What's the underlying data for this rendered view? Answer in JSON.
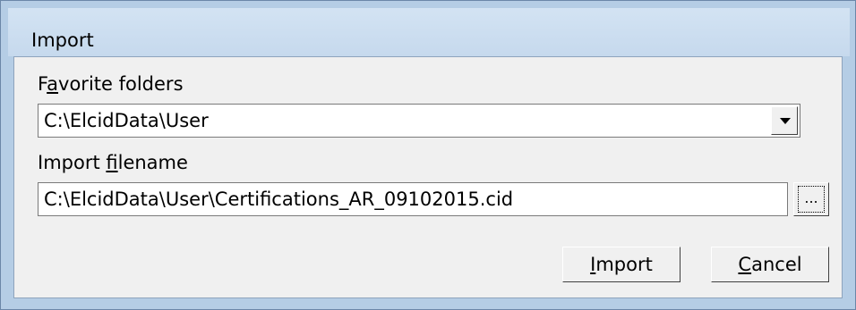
{
  "window": {
    "title": "Import"
  },
  "favorites": {
    "label_pre": "F",
    "label_mnemonic": "a",
    "label_post": "vorite folders",
    "selected_value": "C:\\ElcidData\\User",
    "dropdown_icon": "chevron-down-icon"
  },
  "filename": {
    "label_pre": "Import ",
    "label_mnemonic": "f",
    "label_post": "ilename",
    "value": "C:\\ElcidData\\User\\Certifications_AR_09102015.cid",
    "browse_label": "..."
  },
  "buttons": {
    "import_mnemonic": "I",
    "import_rest": "mport",
    "cancel_mnemonic": "C",
    "cancel_rest": "ancel"
  }
}
